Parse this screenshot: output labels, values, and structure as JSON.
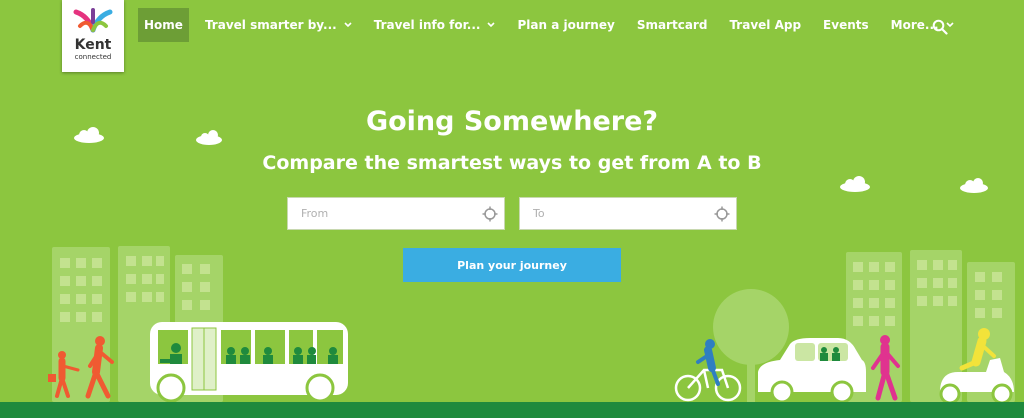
{
  "logo": {
    "word": "Kent",
    "sub": "connected"
  },
  "nav": {
    "home": "Home",
    "travel_smarter": "Travel smarter by...",
    "travel_info": "Travel info for...",
    "plan_journey": "Plan a journey",
    "smartcard": "Smartcard",
    "travel_app": "Travel App",
    "events": "Events",
    "more": "More..."
  },
  "hero": {
    "title": "Going Somewhere?",
    "subtitle": "Compare the smartest ways to get from A to B"
  },
  "search": {
    "from_placeholder": "From",
    "to_placeholder": "To",
    "button_label": "Plan your journey"
  },
  "colors": {
    "background": "#8cc63f",
    "nav_active": "#6d9e36",
    "button": "#3aade2",
    "ground": "#1f8a3d"
  },
  "icons": [
    "search-icon",
    "chevron-down-icon",
    "location-target-icon"
  ]
}
